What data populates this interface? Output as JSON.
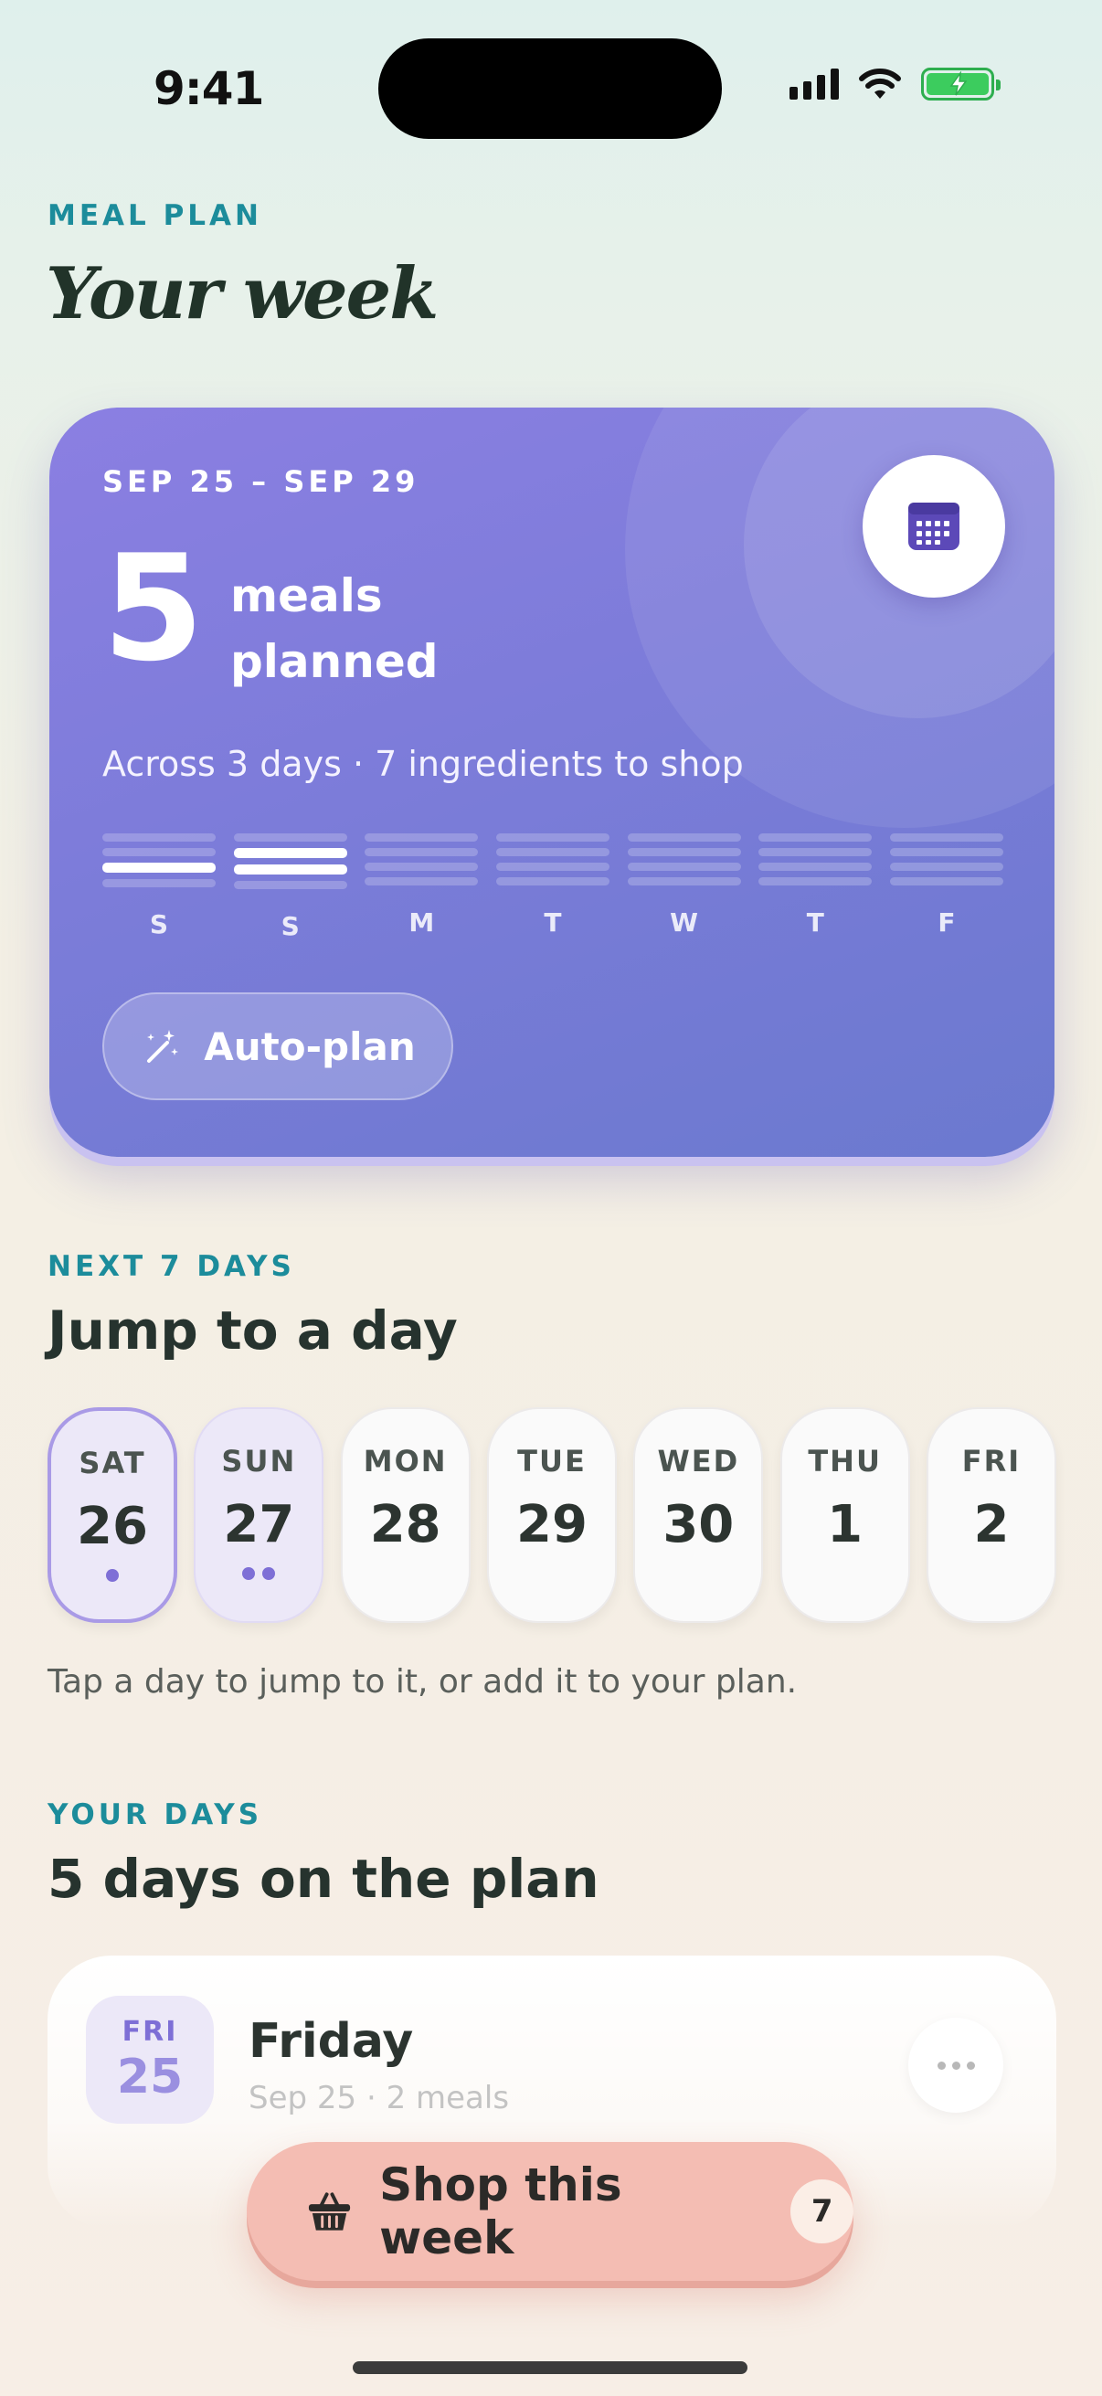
{
  "status_bar": {
    "time": "9:41"
  },
  "header": {
    "eyebrow": "MEAL PLAN",
    "title": "Your week"
  },
  "summary_card": {
    "date_range": "SEP 25 – SEP 29",
    "meal_count": "5",
    "meal_label": "meals planned",
    "subtitle": "Across 3 days · 7 ingredients to shop",
    "week_days": [
      {
        "letter": "S",
        "meals": 1
      },
      {
        "letter": "S",
        "meals": 2
      },
      {
        "letter": "M",
        "meals": 0
      },
      {
        "letter": "T",
        "meals": 0
      },
      {
        "letter": "W",
        "meals": 0
      },
      {
        "letter": "T",
        "meals": 0
      },
      {
        "letter": "F",
        "meals": 0
      }
    ],
    "autoplan_label": "Auto-plan",
    "calendar_icon": "calendar-icon",
    "accent_color": "#7c7cd9"
  },
  "next_days": {
    "eyebrow": "NEXT 7 DAYS",
    "title": "Jump to a day",
    "days": [
      {
        "name": "SAT",
        "num": "26",
        "dots": 1,
        "state": "selected"
      },
      {
        "name": "SUN",
        "num": "27",
        "dots": 2,
        "state": "planned"
      },
      {
        "name": "MON",
        "num": "28",
        "dots": 0,
        "state": "empty"
      },
      {
        "name": "TUE",
        "num": "29",
        "dots": 0,
        "state": "empty"
      },
      {
        "name": "WED",
        "num": "30",
        "dots": 0,
        "state": "empty"
      },
      {
        "name": "THU",
        "num": "1",
        "dots": 0,
        "state": "empty"
      },
      {
        "name": "FRI",
        "num": "2",
        "dots": 0,
        "state": "empty"
      }
    ],
    "hint": "Tap a day to jump to it, or add it to your plan."
  },
  "your_days": {
    "eyebrow": "YOUR DAYS",
    "title": "5 days on the plan",
    "items": [
      {
        "month": "FRI",
        "day": "25",
        "name": "Friday",
        "sub": "Sep 25 · 2 meals"
      }
    ]
  },
  "shop_button": {
    "label": "Shop this week",
    "count": "7",
    "icon": "basket-icon"
  }
}
